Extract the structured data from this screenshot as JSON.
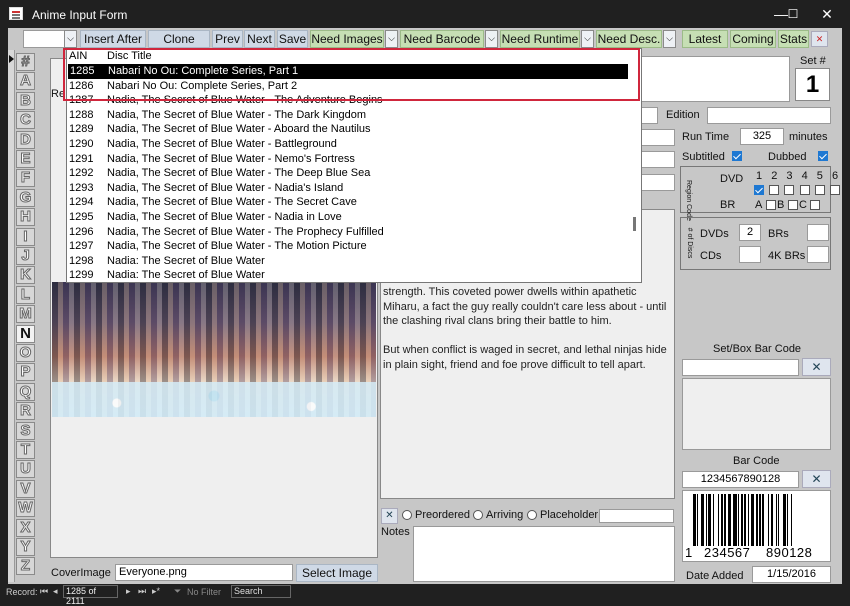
{
  "window": {
    "title": "Anime Input Form",
    "minimize": "—",
    "maximize": "☐",
    "close": "✕"
  },
  "toolbar": {
    "insert_after": "Insert After",
    "clone": "Clone",
    "prev": "Prev",
    "next": "Next",
    "save": "Save",
    "need_images": "Need Images",
    "need_barcode": "Need Barcode",
    "need_runtime": "Need Runtime",
    "need_desc": "Need Desc.",
    "latest": "Latest",
    "coming": "Coming",
    "stats": "Stats"
  },
  "alphabet": [
    "#",
    "A",
    "B",
    "C",
    "D",
    "E",
    "F",
    "G",
    "H",
    "I",
    "J",
    "K",
    "L",
    "M",
    "N",
    "O",
    "P",
    "Q",
    "R",
    "S",
    "T",
    "U",
    "V",
    "W",
    "X",
    "Y",
    "Z"
  ],
  "alphabet_selected": "N",
  "dropdown": {
    "headers": {
      "ain": "AIN",
      "title": "Disc Title"
    },
    "rows": [
      {
        "ain": "1285",
        "title": "Nabari No Ou: Complete Series, Part 1"
      },
      {
        "ain": "1286",
        "title": "Nabari No Ou: Complete Series, Part 2"
      },
      {
        "ain": "1287",
        "title": "Nadia, The Secret of Blue Water - The Adventure Begins"
      },
      {
        "ain": "1288",
        "title": "Nadia, The Secret of Blue Water - The Dark Kingdom"
      },
      {
        "ain": "1289",
        "title": "Nadia, The Secret of Blue Water - Aboard the Nautilus"
      },
      {
        "ain": "1290",
        "title": "Nadia, The Secret of Blue Water - Battleground"
      },
      {
        "ain": "1291",
        "title": "Nadia, The Secret of Blue Water - Nemo's Fortress"
      },
      {
        "ain": "1292",
        "title": "Nadia, The Secret of Blue Water - The Deep Blue Sea"
      },
      {
        "ain": "1293",
        "title": "Nadia, The Secret of Blue Water - Nadia's Island"
      },
      {
        "ain": "1294",
        "title": "Nadia, The Secret of Blue Water - The Secret Cave"
      },
      {
        "ain": "1295",
        "title": "Nadia, The Secret of Blue Water - Nadia in Love"
      },
      {
        "ain": "1296",
        "title": "Nadia, The Secret of Blue Water - The Prophecy Fulfilled"
      },
      {
        "ain": "1297",
        "title": "Nadia, The Secret of Blue Water - The Motion Picture"
      },
      {
        "ain": "1298",
        "title": "Nadia: The Secret of Blue Water"
      },
      {
        "ain": "1299",
        "title": "Nadia: The Secret of Blue Water"
      }
    ],
    "selected_ain": "1285"
  },
  "form": {
    "set_label": "Set #",
    "set_value": "1",
    "re_label": "Re",
    "edition_label": "Edition",
    "edition_value": "",
    "run_time_label": "Run Time",
    "run_time_value": "325",
    "minutes_label": "minutes",
    "subtitled_label": "Subtitled",
    "dubbed_label": "Dubbed",
    "region_label": "Region Code",
    "dvd_label": "DVD",
    "br_label": "BR",
    "dvd_regions": [
      "1",
      "2",
      "3",
      "4",
      "5",
      "6"
    ],
    "br_regions": [
      "A",
      "B",
      "C"
    ],
    "discs_label": "# of Discs",
    "dvds_label": "DVDs",
    "dvds_value": "2",
    "brs_label": "BRs",
    "cds_label": "CDs",
    "k4_label": "4K BRs",
    "description": "strength. This coveted power dwells within apathetic Miharu, a fact the guy really couldn't care less about - until the clashing rival clans bring their battle to him.\n\nBut when conflict is waged in secret, and lethal ninjas hide in plain sight, friend and foe prove difficult to tell apart.",
    "preordered_label": "Preordered",
    "arriving_label": "Arriving",
    "placeholder_label": "Placeholder",
    "notes_label": "Notes",
    "set_box_barcode_label": "Set/Box Bar Code",
    "barcode_label": "Bar Code",
    "barcode_value": "1234567890128",
    "barcode_digits_left": "1",
    "barcode_digits_mid": "234567",
    "barcode_digits_right": "890128",
    "date_added_label": "Date Added",
    "date_added_value": "1/15/2016",
    "cover_image_label": "CoverImage",
    "cover_image_value": "Everyone.png",
    "select_image": "Select Image"
  },
  "status": {
    "record_label": "Record:",
    "record_value": "1285 of 2111",
    "no_filter": "No Filter",
    "search": "Search"
  }
}
